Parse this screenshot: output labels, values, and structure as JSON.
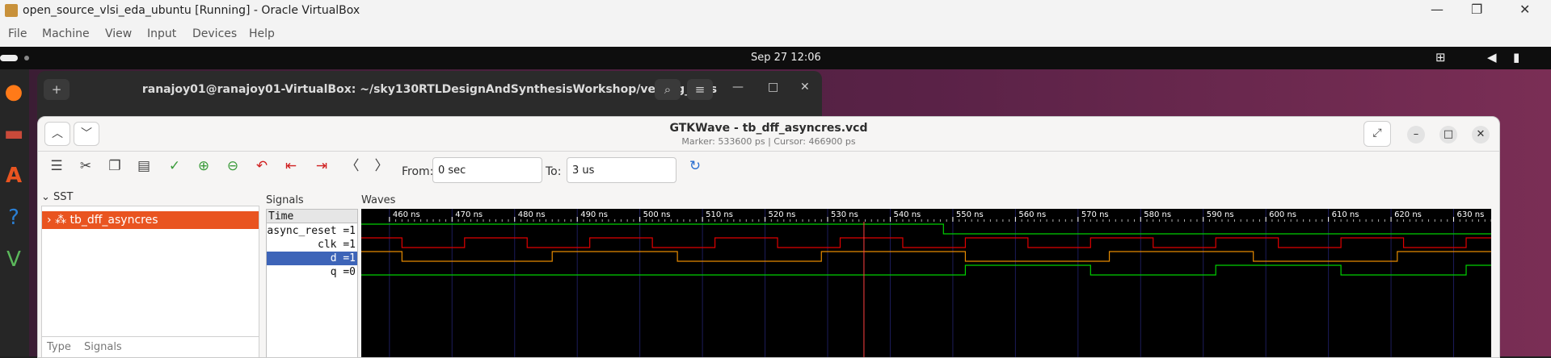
{
  "vbox": {
    "title": "open_source_vlsi_eda_ubuntu [Running] - Oracle VirtualBox",
    "controls": [
      "—",
      "❐",
      "✕"
    ],
    "menu": [
      "File",
      "Machine",
      "View",
      "Input",
      "Devices",
      "Help"
    ]
  },
  "gnome": {
    "clock": "Sep 27  12:06"
  },
  "terminal": {
    "title": "ranajoy01@ranajoy01-VirtualBox: ~/sky130RTLDesignAndSynthesisWorkshop/verilog_files"
  },
  "gtkwave": {
    "title": "GTKWave - tb_dff_asyncres.vcd",
    "subtitle": "Marker: 533600 ps  |  Cursor: 466900 ps",
    "from_label": "From:",
    "from_value": "0 sec",
    "to_label": "To:",
    "to_value": "3 us",
    "sst_label": "SST",
    "sst_item": "tb_dff_asyncres",
    "type_col": "Type",
    "signals_col": "Signals",
    "signals_header": "Signals",
    "waves_header": "Waves",
    "signal_names": [
      "Time",
      "async_reset =1",
      "clk =1",
      "d =1",
      "q =0"
    ],
    "time_ticks": [
      "460 ns",
      "470 ns",
      "480 ns",
      "490 ns",
      "500 ns",
      "510 ns",
      "520 ns",
      "530 ns",
      "540 ns",
      "550 ns",
      "560 ns",
      "570 ns",
      "580 ns",
      "590 ns",
      "600 ns",
      "610 ns",
      "620 ns",
      "630 ns"
    ],
    "colors": {
      "accent": "#e95420",
      "wave_green": "#00d000",
      "wave_red": "#e00000",
      "wave_orange": "#e58a00",
      "marker": "#ff4040",
      "selected": "#3d64b8"
    }
  },
  "waves": {
    "time_start_ns": 455.5,
    "time_end_ns": 636,
    "marker_ns": 535.8,
    "async_reset": {
      "init": 1,
      "edges": [
        [
          548.5,
          0
        ]
      ]
    },
    "clk": {
      "init": 1,
      "edges": [
        [
          462,
          0
        ],
        [
          472,
          1
        ],
        [
          482,
          0
        ],
        [
          492,
          1
        ],
        [
          502,
          0
        ],
        [
          512,
          1
        ],
        [
          522,
          0
        ],
        [
          532,
          1
        ],
        [
          542,
          0
        ],
        [
          552,
          1
        ],
        [
          562,
          0
        ],
        [
          572,
          1
        ],
        [
          582,
          0
        ],
        [
          592,
          1
        ],
        [
          602,
          0
        ],
        [
          612,
          1
        ],
        [
          622,
          0
        ],
        [
          632,
          1
        ]
      ]
    },
    "d": {
      "init": 1,
      "edges": [
        [
          462,
          0
        ],
        [
          486,
          1
        ],
        [
          506,
          0
        ],
        [
          529,
          1
        ],
        [
          552,
          0
        ],
        [
          575,
          1
        ],
        [
          598,
          0
        ],
        [
          621,
          1
        ]
      ]
    },
    "q": {
      "init": 0,
      "edges": [
        [
          552,
          1
        ],
        [
          572,
          0
        ],
        [
          592,
          1
        ],
        [
          612,
          0
        ],
        [
          632,
          1
        ]
      ]
    }
  }
}
